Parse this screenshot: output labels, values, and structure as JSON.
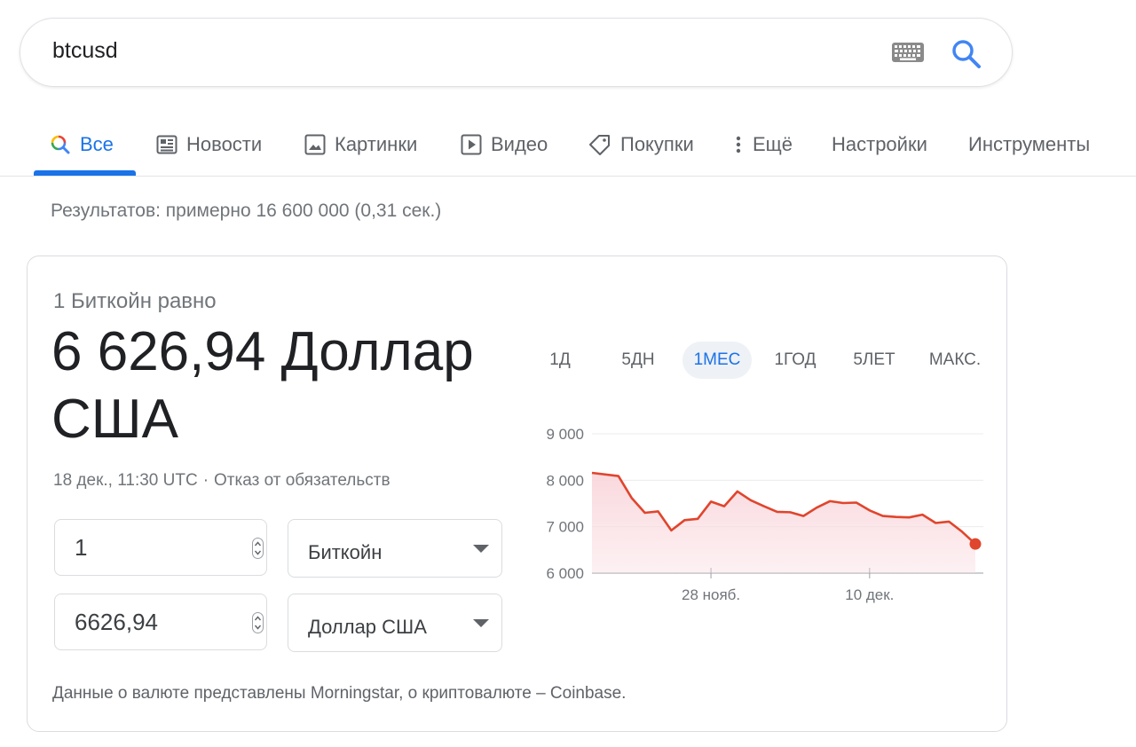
{
  "search": {
    "query": "btcusd",
    "keyboard_icon": "keyboard-icon",
    "search_icon": "search-icon"
  },
  "tabs": [
    {
      "label": "Все",
      "icon": "search-multicolor-icon",
      "active": true
    },
    {
      "label": "Новости",
      "icon": "newspaper-icon"
    },
    {
      "label": "Картинки",
      "icon": "image-icon"
    },
    {
      "label": "Видео",
      "icon": "play-icon"
    },
    {
      "label": "Покупки",
      "icon": "tag-icon"
    },
    {
      "label": "Ещё",
      "icon": "more-vert-icon"
    },
    {
      "label": "Настройки"
    },
    {
      "label": "Инструменты"
    }
  ],
  "results_stats": "Результатов: примерно 16 600 000 (0,31 сек.)",
  "converter": {
    "equals_label": "1 Биткойн равно",
    "value": "6 626,94 Доллар США",
    "timestamp": "18 дек., 11:30 UTC",
    "separator": "·",
    "disclaimer": "Отказ от обязательств",
    "from_amount": "1",
    "from_currency": "Биткойн",
    "to_amount": "6626,94",
    "to_currency": "Доллар США",
    "source_note": "Данные о валюте представлены Morningstar, о криптовалюте – Coinbase.",
    "ranges": [
      "1Д",
      "5ДН",
      "1МЕС",
      "1ГОД",
      "5ЛЕТ",
      "МАКС."
    ],
    "active_range": "1МЕС"
  },
  "colors": {
    "accent": "#1a73e8",
    "line": "#e0452d",
    "fill": "#f9d7dc"
  },
  "chart_data": {
    "type": "area",
    "title": "",
    "xlabel": "",
    "ylabel": "",
    "y_ticks": [
      6000,
      7000,
      8000,
      9000
    ],
    "y_tick_labels": [
      "6 000",
      "7 000",
      "8 000",
      "9 000"
    ],
    "ylim": [
      6000,
      9000
    ],
    "x_ticks": [
      {
        "day": 9,
        "label": "28 нояб."
      },
      {
        "day": 21,
        "label": "10 дек."
      }
    ],
    "xlim": [
      0,
      29
    ],
    "grid": true,
    "series": [
      {
        "x": [
          0,
          2,
          3,
          4,
          5,
          6,
          7,
          8,
          9,
          10,
          11,
          12,
          13,
          14,
          15,
          16,
          17,
          18,
          19,
          20,
          21,
          22,
          23,
          24,
          25,
          26,
          27,
          28,
          29
        ],
        "values": [
          8160,
          8090,
          7620,
          7300,
          7330,
          6920,
          7140,
          7170,
          7540,
          7440,
          7760,
          7570,
          7440,
          7320,
          7310,
          7230,
          7410,
          7550,
          7510,
          7520,
          7350,
          7230,
          7210,
          7200,
          7260,
          7080,
          7110,
          6890,
          6627
        ]
      }
    ]
  }
}
